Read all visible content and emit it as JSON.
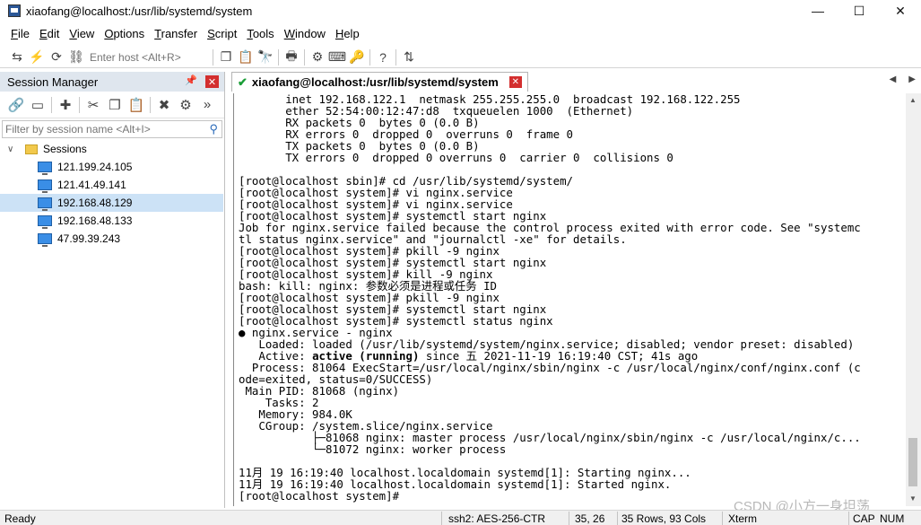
{
  "window": {
    "title": "xiaofang@localhost:/usr/lib/systemd/system",
    "minimize_glyph": "—",
    "maximize_glyph": "☐",
    "close_glyph": "✕"
  },
  "menu": [
    "File",
    "Edit",
    "View",
    "Options",
    "Transfer",
    "Script",
    "Tools",
    "Window",
    "Help"
  ],
  "toolbar": {
    "host_placeholder": "Enter host <Alt+R>",
    "icons": [
      "connect-icon",
      "quick-connect-icon",
      "reconnect-icon",
      "disconnect-icon",
      "copy-icon",
      "paste-icon",
      "find-icon",
      "print-icon",
      "settings-icon",
      "keymap-icon",
      "key-icon",
      "help-icon",
      "sftp-icon"
    ]
  },
  "session_manager": {
    "title": "Session Manager",
    "pin_glyph": "📌",
    "close_glyph": "✕",
    "filter_placeholder": "Filter by session name <Alt+I>",
    "more_glyph": "»",
    "root_folder": "Sessions",
    "sessions": [
      "121.199.24.105",
      "121.41.49.141",
      "192.168.48.129",
      "192.168.48.133",
      "47.99.39.243"
    ],
    "selected_index": 2
  },
  "tab": {
    "label": "xiaofang@localhost:/usr/lib/systemd/system",
    "check_glyph": "✔",
    "close_glyph": "✕",
    "nav_left": "◀",
    "nav_right": "▶"
  },
  "terminal": {
    "lines": [
      "       inet 192.168.122.1  netmask 255.255.255.0  broadcast 192.168.122.255",
      "       ether 52:54:00:12:47:d8  txqueuelen 1000  (Ethernet)",
      "       RX packets 0  bytes 0 (0.0 B)",
      "       RX errors 0  dropped 0  overruns 0  frame 0",
      "       TX packets 0  bytes 0 (0.0 B)",
      "       TX errors 0  dropped 0 overruns 0  carrier 0  collisions 0",
      "",
      "[root@localhost sbin]# cd /usr/lib/systemd/system/",
      "[root@localhost system]# vi nginx.service",
      "[root@localhost system]# vi nginx.service",
      "[root@localhost system]# systemctl start nginx",
      "Job for nginx.service failed because the control process exited with error code. See \"systemc",
      "tl status nginx.service\" and \"journalctl -xe\" for details.",
      "[root@localhost system]# pkill -9 nginx",
      "[root@localhost system]# systemctl start nginx",
      "[root@localhost system]# kill -9 nginx",
      "bash: kill: nginx: 参数必须是进程或任务 ID",
      "[root@localhost system]# pkill -9 nginx",
      "[root@localhost system]# systemctl start nginx",
      "[root@localhost system]# systemctl status nginx",
      "● nginx.service - nginx",
      "   Loaded: loaded (/usr/lib/systemd/system/nginx.service; disabled; vendor preset: disabled)",
      "   Active: active (running) since 五 2021-11-19 16:19:40 CST; 41s ago",
      "  Process: 81064 ExecStart=/usr/local/nginx/sbin/nginx -c /usr/local/nginx/conf/nginx.conf (c",
      "ode=exited, status=0/SUCCESS)",
      " Main PID: 81068 (nginx)",
      "    Tasks: 2",
      "   Memory: 984.0K",
      "   CGroup: /system.slice/nginx.service",
      "           ├─81068 nginx: master process /usr/local/nginx/sbin/nginx -c /usr/local/nginx/c...",
      "           └─81072 nginx: worker process",
      "",
      "11月 19 16:19:40 localhost.localdomain systemd[1]: Starting nginx...",
      "11月 19 16:19:40 localhost.localdomain systemd[1]: Started nginx.",
      "[root@localhost system]#"
    ]
  },
  "status": {
    "ready": "Ready",
    "cipher": "ssh2: AES-256-CTR",
    "cursor": "35,  26",
    "size": "35 Rows, 93 Cols",
    "term_type": "Xterm",
    "cap": "CAP",
    "num": "NUM"
  },
  "watermark": "CSDN @小方一身坦荡"
}
